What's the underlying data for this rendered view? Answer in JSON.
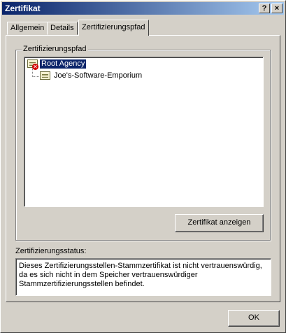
{
  "window": {
    "title": "Zertifikat",
    "help_button": "?",
    "close_button": "×"
  },
  "tabs": [
    {
      "label": "Allgemein"
    },
    {
      "label": "Details"
    },
    {
      "label": "Zertifizierungspfad",
      "active": true
    }
  ],
  "path_group": {
    "label": "Zertifizierungspfad",
    "tree": [
      {
        "label": "Root Agency",
        "selected": true,
        "icon": "certificate-error-icon"
      },
      {
        "label": "Joe's-Software-Emporium",
        "selected": false,
        "icon": "certificate-icon"
      }
    ],
    "view_button": "Zertifikat anzeigen"
  },
  "status": {
    "label": "Zertifizierungsstatus:",
    "text": "Dieses Zertifizierungsstellen-Stammzertifikat ist nicht vertrauenswürdig, da es sich nicht in dem Speicher vertrauenswürdiger Stammzertifizierungsstellen befindet."
  },
  "footer": {
    "ok_button": "OK"
  },
  "colors": {
    "dialog_bg": "#d4d0c8",
    "title_gradient_start": "#0a246a",
    "title_gradient_end": "#a6caf0",
    "selection_bg": "#0a246a",
    "error_badge": "#d40000"
  }
}
